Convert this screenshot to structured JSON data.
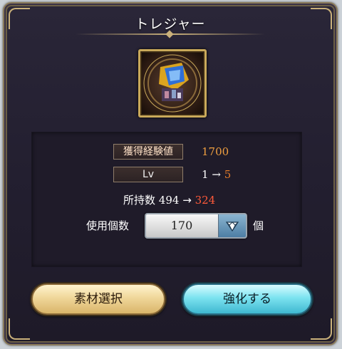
{
  "dialog": {
    "title": "トレジャー",
    "item_icon": "treasure-crystal-icon"
  },
  "stats": {
    "exp_label": "獲得経験値",
    "exp_value": "1700",
    "lv_label": "Lv",
    "lv_current": "1",
    "lv_arrow": "→",
    "lv_new": "5",
    "owned_label": "所持数",
    "owned_current": "494",
    "owned_arrow": "→",
    "owned_new": "324"
  },
  "use": {
    "label": "使用個数",
    "value": "170",
    "unit": "個",
    "dropdown_icon": "diamond-chevron-icon"
  },
  "buttons": {
    "select_label": "素材選択",
    "enhance_label": "強化する"
  },
  "colors": {
    "exp_value": "#f0a040",
    "lv_new": "#e07a2a",
    "owned_new": "#ff5a3a",
    "select_button": "#e8c67f",
    "enhance_button": "#6fd6e8"
  }
}
